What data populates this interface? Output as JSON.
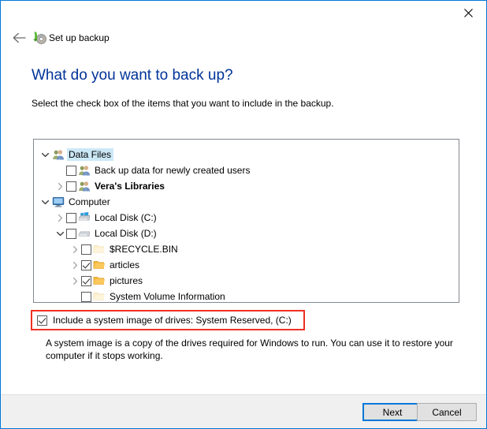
{
  "window": {
    "border_color": "#0078d7",
    "close_label": "Close"
  },
  "header": {
    "back_label": "Back",
    "app_icon": "backup-icon",
    "title": "Set up backup"
  },
  "content": {
    "heading": "What do you want to back up?",
    "heading_color": "#003399",
    "instruction": "Select the check box of the items that you want to include in the backup."
  },
  "tree": {
    "selection_color": "#cce8f7",
    "items": [
      {
        "id": "data-files",
        "label": "Data Files",
        "indent": 0,
        "expander": "expanded",
        "checkbox": "none",
        "icon": "users-icon",
        "selected": true,
        "bold": false
      },
      {
        "id": "backup-new-users",
        "label": "Back up data for newly created users",
        "indent": 1,
        "expander": "none",
        "checkbox": "unchecked",
        "icon": "users-icon",
        "selected": false,
        "bold": false
      },
      {
        "id": "vera-libraries",
        "label": "Vera's Libraries",
        "indent": 1,
        "expander": "collapsed",
        "checkbox": "unchecked",
        "icon": "users-icon",
        "selected": false,
        "bold": true
      },
      {
        "id": "computer",
        "label": "Computer",
        "indent": 0,
        "expander": "expanded",
        "checkbox": "none",
        "icon": "monitor-icon",
        "selected": false,
        "bold": false
      },
      {
        "id": "local-disk-c",
        "label": "Local Disk (C:)",
        "indent": 1,
        "expander": "collapsed",
        "checkbox": "unchecked",
        "icon": "windows-drive-icon",
        "selected": false,
        "bold": false
      },
      {
        "id": "local-disk-d",
        "label": "Local Disk (D:)",
        "indent": 1,
        "expander": "expanded",
        "checkbox": "unchecked",
        "icon": "drive-icon",
        "selected": false,
        "bold": false
      },
      {
        "id": "recycle-bin",
        "label": "$RECYCLE.BIN",
        "indent": 2,
        "expander": "collapsed",
        "checkbox": "unchecked",
        "icon": "folder-dim-icon",
        "selected": false,
        "bold": false
      },
      {
        "id": "articles",
        "label": "articles",
        "indent": 2,
        "expander": "collapsed",
        "checkbox": "checked",
        "icon": "folder-icon",
        "selected": false,
        "bold": false
      },
      {
        "id": "pictures",
        "label": "pictures",
        "indent": 2,
        "expander": "collapsed",
        "checkbox": "checked",
        "icon": "folder-icon",
        "selected": false,
        "bold": false
      },
      {
        "id": "system-volume-information",
        "label": "System Volume Information",
        "indent": 2,
        "expander": "none",
        "checkbox": "unchecked",
        "icon": "folder-dim-icon",
        "selected": false,
        "bold": false
      }
    ]
  },
  "system_image": {
    "checked": true,
    "label": "Include a system image of drives: System Reserved, (C:)",
    "highlight_color": "#ee3124",
    "description": "A system image is a copy of the drives required for Windows to run. You can use it to restore your computer if it stops working."
  },
  "footer": {
    "next_label": "Next",
    "cancel_label": "Cancel",
    "default_button_color": "#0078d7"
  }
}
